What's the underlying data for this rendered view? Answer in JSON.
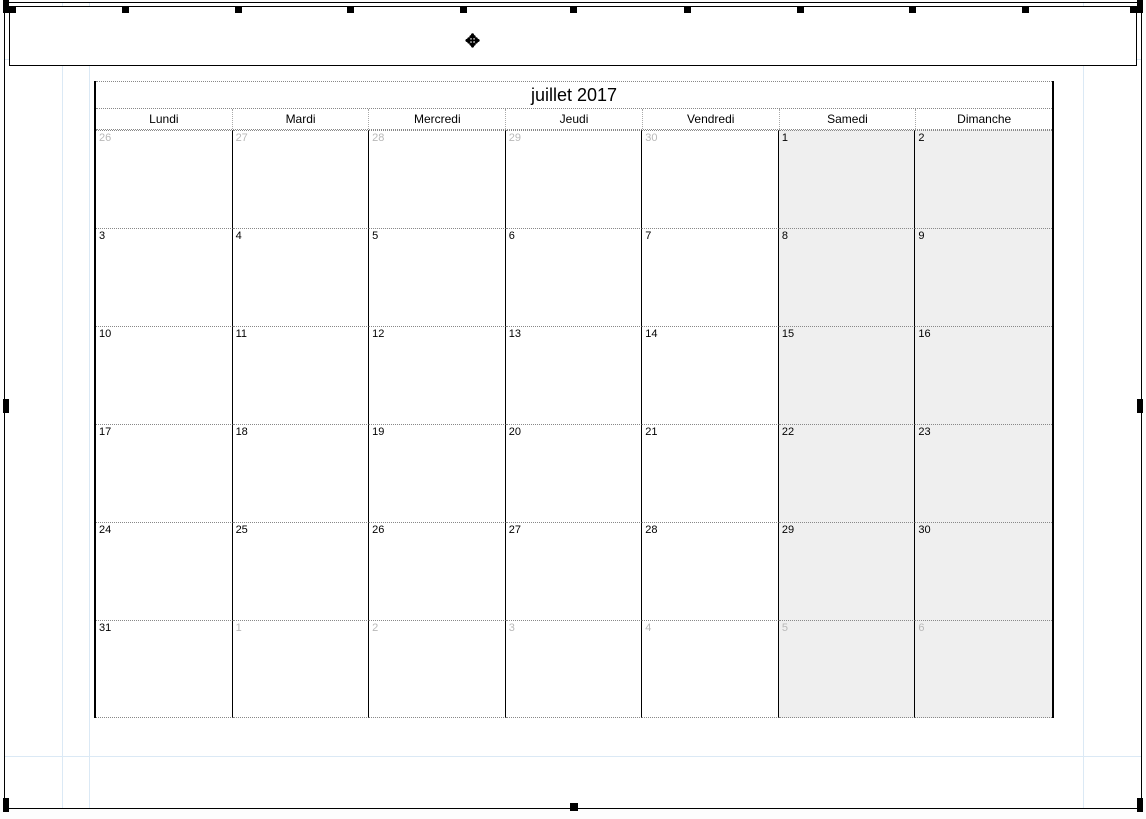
{
  "calendar": {
    "title": "juillet 2017",
    "weekdays": [
      "Lundi",
      "Mardi",
      "Mercredi",
      "Jeudi",
      "Vendredi",
      "Samedi",
      "Dimanche"
    ],
    "cells": [
      {
        "n": "26",
        "dim": true,
        "we": false
      },
      {
        "n": "27",
        "dim": true,
        "we": false
      },
      {
        "n": "28",
        "dim": true,
        "we": false
      },
      {
        "n": "29",
        "dim": true,
        "we": false
      },
      {
        "n": "30",
        "dim": true,
        "we": false
      },
      {
        "n": "1",
        "dim": false,
        "we": true
      },
      {
        "n": "2",
        "dim": false,
        "we": true
      },
      {
        "n": "3",
        "dim": false,
        "we": false
      },
      {
        "n": "4",
        "dim": false,
        "we": false
      },
      {
        "n": "5",
        "dim": false,
        "we": false
      },
      {
        "n": "6",
        "dim": false,
        "we": false
      },
      {
        "n": "7",
        "dim": false,
        "we": false
      },
      {
        "n": "8",
        "dim": false,
        "we": true
      },
      {
        "n": "9",
        "dim": false,
        "we": true
      },
      {
        "n": "10",
        "dim": false,
        "we": false
      },
      {
        "n": "11",
        "dim": false,
        "we": false
      },
      {
        "n": "12",
        "dim": false,
        "we": false
      },
      {
        "n": "13",
        "dim": false,
        "we": false
      },
      {
        "n": "14",
        "dim": false,
        "we": false
      },
      {
        "n": "15",
        "dim": false,
        "we": true
      },
      {
        "n": "16",
        "dim": false,
        "we": true
      },
      {
        "n": "17",
        "dim": false,
        "we": false
      },
      {
        "n": "18",
        "dim": false,
        "we": false
      },
      {
        "n": "19",
        "dim": false,
        "we": false
      },
      {
        "n": "20",
        "dim": false,
        "we": false
      },
      {
        "n": "21",
        "dim": false,
        "we": false
      },
      {
        "n": "22",
        "dim": false,
        "we": true
      },
      {
        "n": "23",
        "dim": false,
        "we": true
      },
      {
        "n": "24",
        "dim": false,
        "we": false
      },
      {
        "n": "25",
        "dim": false,
        "we": false
      },
      {
        "n": "26",
        "dim": false,
        "we": false
      },
      {
        "n": "27",
        "dim": false,
        "we": false
      },
      {
        "n": "28",
        "dim": false,
        "we": false
      },
      {
        "n": "29",
        "dim": false,
        "we": true
      },
      {
        "n": "30",
        "dim": false,
        "we": true
      },
      {
        "n": "31",
        "dim": false,
        "we": false
      },
      {
        "n": "1",
        "dim": true,
        "we": false
      },
      {
        "n": "2",
        "dim": true,
        "we": false
      },
      {
        "n": "3",
        "dim": true,
        "we": false
      },
      {
        "n": "4",
        "dim": true,
        "we": false
      },
      {
        "n": "5",
        "dim": true,
        "we": true
      },
      {
        "n": "6",
        "dim": true,
        "we": true
      }
    ]
  }
}
